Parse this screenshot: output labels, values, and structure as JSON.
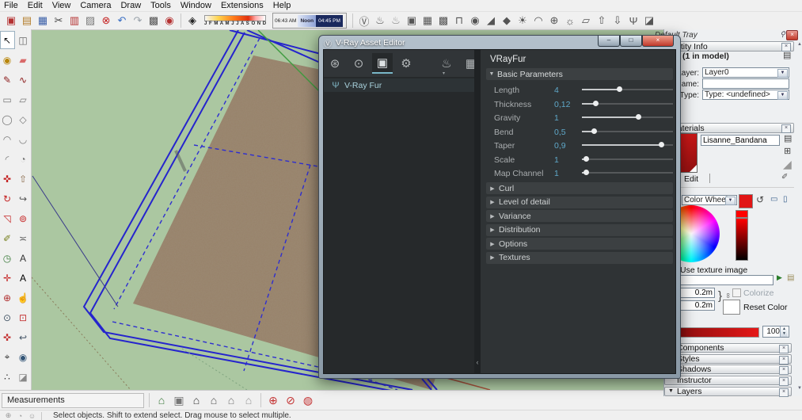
{
  "menu": {
    "items": [
      {
        "name": "menu-file",
        "label": "File"
      },
      {
        "name": "menu-edit",
        "label": "Edit"
      },
      {
        "name": "menu-view",
        "label": "View"
      },
      {
        "name": "menu-camera",
        "label": "Camera"
      },
      {
        "name": "menu-draw",
        "label": "Draw"
      },
      {
        "name": "menu-tools",
        "label": "Tools"
      },
      {
        "name": "menu-window",
        "label": "Window"
      },
      {
        "name": "menu-extensions",
        "label": "Extensions"
      },
      {
        "name": "menu-help",
        "label": "Help"
      }
    ]
  },
  "toolbar": {
    "standard": [
      {
        "name": "new-icon",
        "glyph": "▣",
        "color": "#b43131"
      },
      {
        "name": "open-icon",
        "glyph": "▤",
        "color": "#b37d2a"
      },
      {
        "name": "save-icon",
        "glyph": "▦",
        "color": "#3a5fa8"
      },
      {
        "name": "cut-icon",
        "glyph": "✂",
        "color": "#444444"
      },
      {
        "name": "copy-icon",
        "glyph": "▥",
        "color": "#b43131"
      },
      {
        "name": "paste-icon",
        "glyph": "▨",
        "color": "#7a7a7a"
      },
      {
        "name": "erase-icon",
        "glyph": "⊗",
        "color": "#c42222"
      },
      {
        "name": "undo-icon",
        "glyph": "↶",
        "color": "#3a6fc4"
      },
      {
        "name": "redo-icon",
        "glyph": "↷",
        "color": "#9aa2aa"
      },
      {
        "name": "print-icon",
        "glyph": "▩",
        "color": "#555555"
      },
      {
        "name": "model-info-icon",
        "glyph": "◉",
        "color": "#b43131"
      }
    ],
    "shadows": {
      "toggle_glyph": "◈",
      "months": "J F M A M J J A S O N D",
      "time_start": "06:43 AM",
      "time_noon": "Noon",
      "time_end": "04:45 PM"
    },
    "vray": [
      {
        "name": "vray-logo-icon",
        "glyph": "Ⓥ",
        "color": "#555555"
      },
      {
        "name": "render-icon",
        "glyph": "♨",
        "color": "#555555"
      },
      {
        "name": "render-interactive-icon",
        "glyph": "♨",
        "color": "#888888"
      },
      {
        "name": "frame-buffer-icon",
        "glyph": "▣",
        "color": "#555555"
      },
      {
        "name": "batch-render-icon",
        "glyph": "▦",
        "color": "#555555"
      },
      {
        "name": "lock-frame-buffer-icon",
        "glyph": "▩",
        "color": "#555555"
      },
      {
        "name": "rect-light-icon",
        "glyph": "⊓",
        "color": "#555555"
      },
      {
        "name": "sphere-light-icon",
        "glyph": "◉",
        "color": "#555555"
      },
      {
        "name": "spot-light-icon",
        "glyph": "◢",
        "color": "#555555"
      },
      {
        "name": "ies-light-icon",
        "glyph": "◆",
        "color": "#555555"
      },
      {
        "name": "omni-light-icon",
        "glyph": "☀",
        "color": "#555555"
      },
      {
        "name": "dome-light-icon",
        "glyph": "◠",
        "color": "#555555"
      },
      {
        "name": "mesh-light-icon",
        "glyph": "⊕",
        "color": "#555555"
      },
      {
        "name": "sun-light-icon",
        "glyph": "☼",
        "color": "#555555"
      },
      {
        "name": "infinite-plane-icon",
        "glyph": "▱",
        "color": "#555555"
      },
      {
        "name": "export-proxy-icon",
        "glyph": "⇧",
        "color": "#555555"
      },
      {
        "name": "import-proxy-icon",
        "glyph": "⇩",
        "color": "#555555"
      },
      {
        "name": "fur-icon",
        "glyph": "Ψ",
        "color": "#555555"
      },
      {
        "name": "clipper-icon",
        "glyph": "◪",
        "color": "#555555"
      }
    ]
  },
  "tools": [
    {
      "name": "select-tool",
      "glyph": "↖",
      "color": "#111111"
    },
    {
      "name": "make-component-tool",
      "glyph": "◫",
      "color": "#666666"
    },
    {
      "name": "paint-bucket-tool",
      "glyph": "◉",
      "color": "#b8860b"
    },
    {
      "name": "eraser-tool",
      "glyph": "▰",
      "color": "#d96a6a"
    },
    {
      "name": "line-tool",
      "glyph": "✎",
      "color": "#8b1a1a"
    },
    {
      "name": "freehand-tool",
      "glyph": "∿",
      "color": "#8b1a1a"
    },
    {
      "name": "rectangle-tool",
      "glyph": "▭",
      "color": "#777777"
    },
    {
      "name": "rotated-rectangle-tool",
      "glyph": "▱",
      "color": "#777777"
    },
    {
      "name": "circle-tool",
      "glyph": "◯",
      "color": "#777777"
    },
    {
      "name": "polygon-tool",
      "glyph": "◇",
      "color": "#777777"
    },
    {
      "name": "arc-tool",
      "glyph": "◠",
      "color": "#777777"
    },
    {
      "name": "two-point-arc-tool",
      "glyph": "◡",
      "color": "#777777"
    },
    {
      "name": "three-point-arc-tool",
      "glyph": "◜",
      "color": "#777777"
    },
    {
      "name": "pie-tool",
      "glyph": "◔",
      "color": "#777777"
    },
    {
      "name": "move-tool",
      "glyph": "✜",
      "color": "#c42222"
    },
    {
      "name": "push-pull-tool",
      "glyph": "⇧",
      "color": "#8a6a4a"
    },
    {
      "name": "rotate-tool",
      "glyph": "↻",
      "color": "#c42222"
    },
    {
      "name": "follow-me-tool",
      "glyph": "↪",
      "color": "#555555"
    },
    {
      "name": "scale-tool",
      "glyph": "◹",
      "color": "#c42222"
    },
    {
      "name": "offset-tool",
      "glyph": "⊚",
      "color": "#c42222"
    },
    {
      "name": "tape-measure-tool",
      "glyph": "✐",
      "color": "#77801f"
    },
    {
      "name": "dimension-tool",
      "glyph": "≍",
      "color": "#555555"
    },
    {
      "name": "protractor-tool",
      "glyph": "◷",
      "color": "#3a7a3a"
    },
    {
      "name": "text-tool",
      "glyph": "A",
      "color": "#333333"
    },
    {
      "name": "axes-tool",
      "glyph": "✛",
      "color": "#c42222"
    },
    {
      "name": "three-d-text-tool",
      "glyph": "A",
      "color": "#000000"
    },
    {
      "name": "orbit-tool",
      "glyph": "⊕",
      "color": "#b03030"
    },
    {
      "name": "pan-tool",
      "glyph": "☝",
      "color": "#c89a6a"
    },
    {
      "name": "zoom-tool",
      "glyph": "⊙",
      "color": "#445566"
    },
    {
      "name": "zoom-window-tool",
      "glyph": "⊡",
      "color": "#c43333"
    },
    {
      "name": "zoom-extents-tool",
      "glyph": "✜",
      "color": "#c43333"
    },
    {
      "name": "zoom-previous-tool",
      "glyph": "↩",
      "color": "#445566"
    },
    {
      "name": "position-camera-tool",
      "glyph": "⌖",
      "color": "#333333"
    },
    {
      "name": "look-around-tool",
      "glyph": "◉",
      "color": "#335577"
    },
    {
      "name": "walk-tool",
      "glyph": "∴",
      "color": "#333333"
    },
    {
      "name": "section-plane-tool",
      "glyph": "◪",
      "color": "#888888"
    }
  ],
  "viewport": {
    "colors": {
      "background": "#abc7a1",
      "selection_blue": "#2524cd",
      "carpet": "#98826a",
      "axis_green": "#3f9b3f",
      "axis_red": "#a5523c"
    }
  },
  "dialog": {
    "title": "V-Ray Asset Editor",
    "logo_glyph": "Ⓥ",
    "window_buttons": {
      "min": "–",
      "max": "□",
      "close": "×"
    },
    "tabs": [
      {
        "name": "materials-tab",
        "glyph": "⊛"
      },
      {
        "name": "lights-tab",
        "glyph": "⊙"
      },
      {
        "name": "geometry-tab",
        "glyph": "▣"
      },
      {
        "name": "settings-tab",
        "glyph": "⚙"
      }
    ],
    "render_tab": {
      "name": "render-icon",
      "glyph": "♨",
      "dropdown": "▾"
    },
    "framebuffer_tab": {
      "name": "frame-buffer-icon",
      "glyph": "▦"
    },
    "asset_list": [
      {
        "label": "V-Ray Fur",
        "glyph": "Ψ"
      }
    ],
    "collapse_glyph": "‹",
    "panel_title": "VRayFur",
    "basic_header": "Basic Parameters",
    "basic_arrow": "▼",
    "params": [
      {
        "label": "Length",
        "value": "4",
        "fill": "41%"
      },
      {
        "label": "Thickness",
        "value": "0,12",
        "fill": "15%"
      },
      {
        "label": "Gravity",
        "value": "1",
        "fill": "62%"
      },
      {
        "label": "Bend",
        "value": "0,5",
        "fill": "13%"
      },
      {
        "label": "Taper",
        "value": "0,9",
        "fill": "87%"
      },
      {
        "label": "Scale",
        "value": "1",
        "fill": "4%"
      },
      {
        "label": "Map Channel",
        "value": "1",
        "fill": "4%"
      }
    ],
    "sections": [
      {
        "label": "Curl",
        "arrow": "▶"
      },
      {
        "label": "Level of detail",
        "arrow": "▶"
      },
      {
        "label": "Variance",
        "arrow": "▶"
      },
      {
        "label": "Distribution",
        "arrow": "▶"
      },
      {
        "label": "Options",
        "arrow": "▶"
      },
      {
        "label": "Textures",
        "arrow": "▶"
      }
    ]
  },
  "tray": {
    "title": "Default Tray",
    "pin_glyph": "⚲",
    "close_glyph": "×",
    "rollup_glyph": "×",
    "scroll_up": "▲",
    "scroll_down": "▼",
    "entity_info": {
      "header": "Entity Info",
      "count": "(1 in model)",
      "details_glyph": "▤",
      "layer_label": "Layer:",
      "layer_value": "Layer0",
      "name_label": "Name:",
      "name_value": "",
      "type_label": "Type:",
      "type_value": "Type: <undefined>"
    },
    "materials": {
      "header": "Materials",
      "name": "Lisanne_Bandana",
      "pane_glyph": "▤",
      "create_glyph": "⊞",
      "sample_glyph": "◢",
      "tab_edit": "Edit",
      "eyedropper_glyph": "✐",
      "picker_value": "Color Wheel",
      "undo_color_glyph": "↺",
      "match_model_glyph": "▭",
      "match_screen_glyph": "▯",
      "texture_label": "Use texture image",
      "browse_glyph": "▶",
      "texture_stack_glyph": "▤",
      "dim_w": "0.2m",
      "dim_h": "0.2m",
      "brace": "}",
      "lock_glyph": "∞",
      "colorize_label": "Colorize",
      "reset_label": "Reset Color",
      "opacity_value": "100",
      "spin_up": "▲",
      "spin_down": "▼"
    },
    "sections": [
      {
        "label": "Components",
        "arrow": ""
      },
      {
        "label": "Styles",
        "arrow": ""
      },
      {
        "label": "Shadows",
        "arrow": ""
      },
      {
        "label": "Instructor",
        "arrow": ""
      },
      {
        "label": "Layers",
        "arrow": "▼"
      }
    ]
  },
  "viewsbar": {
    "measurements_label": "Measurements",
    "views": [
      {
        "name": "iso-view-icon",
        "glyph": "⌂",
        "color": "#3a7a3a"
      },
      {
        "name": "top-view-icon",
        "glyph": "▣",
        "color": "#777777"
      },
      {
        "name": "front-view-icon",
        "glyph": "⌂",
        "color": "#333333"
      },
      {
        "name": "right-view-icon",
        "glyph": "⌂",
        "color": "#555555"
      },
      {
        "name": "back-view-icon",
        "glyph": "⌂",
        "color": "#777777"
      },
      {
        "name": "left-view-icon",
        "glyph": "⌂",
        "color": "#999999"
      }
    ],
    "sections": [
      {
        "name": "section-plane-icon",
        "glyph": "⊕",
        "color": "#c43333"
      },
      {
        "name": "section-display-icon",
        "glyph": "⊘",
        "color": "#c43333"
      },
      {
        "name": "section-cut-icon",
        "glyph": "◍",
        "color": "#c43333"
      }
    ]
  },
  "status": {
    "icons": [
      {
        "name": "geolocation-icon",
        "glyph": "⊕",
        "color": "#999999"
      },
      {
        "name": "credits-icon",
        "glyph": "◔",
        "color": "#999999"
      },
      {
        "name": "signin-icon",
        "glyph": "☺",
        "color": "#999999"
      }
    ],
    "text": "Select objects. Shift to extend select. Drag mouse to select multiple."
  }
}
